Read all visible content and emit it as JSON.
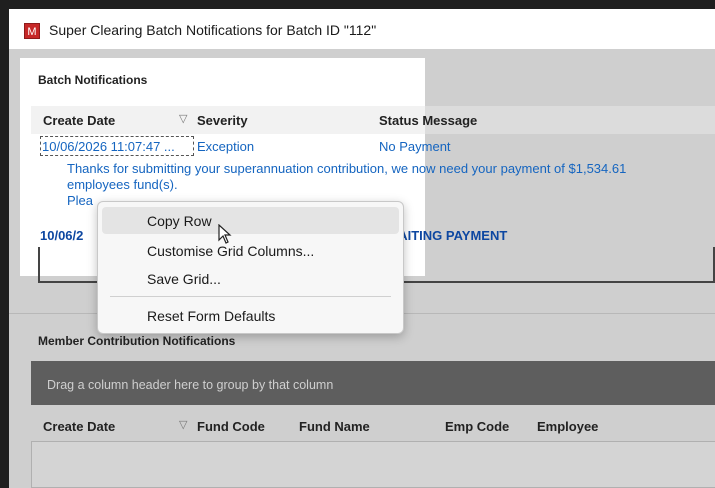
{
  "window": {
    "icon_letter": "M",
    "title": "Super Clearing Batch Notifications for Batch ID \"112\""
  },
  "batch": {
    "section_title": "Batch Notifications",
    "columns": [
      "Create Date",
      "Severity",
      "Status Message"
    ],
    "row1": {
      "create_date": "10/06/2026 11:07:47 ...",
      "severity": "Exception",
      "status": "No Payment",
      "message_line1": "Thanks for submitting your superannuation contribution, we now need your payment of $1,534.61",
      "message_line2": "employees fund(s).",
      "message_line3": "Plea"
    },
    "row2": {
      "create_date": "10/06/2",
      "status": "AWAITING PAYMENT"
    }
  },
  "member": {
    "section_title": "Member Contribution Notifications",
    "group_hint": "Drag a column header here to group by that column",
    "columns": [
      "Create Date",
      "Fund Code",
      "Fund Name",
      "Emp Code",
      "Employee"
    ]
  },
  "context_menu": {
    "items": [
      "Copy Row",
      "Customise Grid Columns...",
      "Save Grid...",
      "Reset Form Defaults"
    ]
  },
  "colors": {
    "accent_link": "#1565c0",
    "app_icon": "#c62828"
  }
}
